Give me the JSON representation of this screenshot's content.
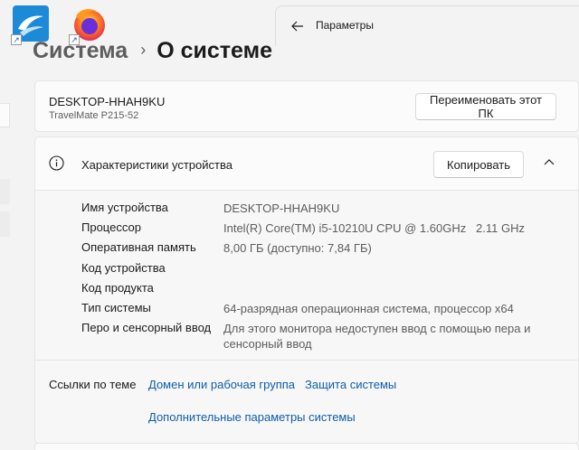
{
  "desktop": {
    "icons": [
      {
        "name": "openoffice-icon"
      },
      {
        "name": "firefox-icon"
      }
    ]
  },
  "window": {
    "app_title": "Параметры"
  },
  "breadcrumb": {
    "parent": "Система",
    "separator": "›",
    "current": "О системе"
  },
  "device": {
    "name": "DESKTOP-HHAH9KU",
    "model": "TravelMate P215-52",
    "rename_label": "Переименовать этот ПК"
  },
  "specs": {
    "title": "Характеристики устройства",
    "copy_label": "Копировать",
    "rows": [
      {
        "label": "Имя устройства",
        "value": "DESKTOP-HHAH9KU"
      },
      {
        "label": "Процессор",
        "value": "Intel(R) Core(TM) i5-10210U CPU @ 1.60GHz   2.11 GHz"
      },
      {
        "label": "Оперативная память",
        "value": "8,00 ГБ (доступно: 7,84 ГБ)"
      },
      {
        "label": "Код устройства",
        "value": ""
      },
      {
        "label": "Код продукта",
        "value": ""
      },
      {
        "label": "Тип системы",
        "value": "64-разрядная операционная система, процессор x64"
      },
      {
        "label": "Перо и сенсорный ввод",
        "value": "Для этого монитора недоступен ввод с помощью пера и сенсорный ввод"
      }
    ]
  },
  "related": {
    "label": "Ссылки по теме",
    "links": [
      {
        "text": "Домен или рабочая группа"
      },
      {
        "text": "Защита системы"
      },
      {
        "text": "Дополнительные параметры системы"
      }
    ]
  },
  "colors": {
    "accent_link": "#0f5ea8",
    "background": "#f3f3f3",
    "card": "#fbfbfb"
  }
}
